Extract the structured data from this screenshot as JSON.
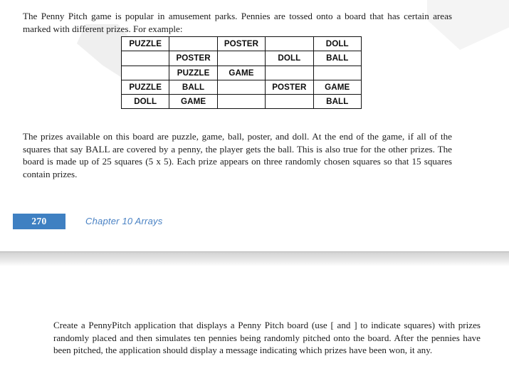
{
  "page_top": {
    "intro_paragraph": "The Penny Pitch game is popular in amusement parks. Pennies are tossed onto a board that has certain areas marked with different prizes. For example:",
    "prizes_paragraph": "The prizes available on this board are puzzle, game, ball, poster, and doll. At the end of the game, if all of the squares that say BALL are covered by a penny, the player gets the ball. This is also true for the other prizes. The board is made up of 25 squares (5 x 5). Each prize appears on three randomly chosen squares so that 15 squares contain prizes."
  },
  "penny_pitch_board": {
    "rows": [
      [
        "PUZZLE",
        "",
        "POSTER",
        "",
        "DOLL"
      ],
      [
        "",
        "POSTER",
        "",
        "DOLL",
        "BALL"
      ],
      [
        "",
        "PUZZLE",
        "GAME",
        "",
        ""
      ],
      [
        "PUZZLE",
        "BALL",
        "",
        "POSTER",
        "GAME"
      ],
      [
        "DOLL",
        "GAME",
        "",
        "",
        "BALL"
      ]
    ]
  },
  "footer": {
    "page_number": "270",
    "chapter_label": "Chapter 10 Arrays",
    "page_number_bg": "#3f80c2",
    "chapter_label_color": "#4a82c4"
  },
  "page_bottom": {
    "exercise_paragraph": "Create a PennyPitch application that displays a Penny Pitch board (use [ and ] to indicate squares) with prizes randomly placed and then simulates ten pennies being randomly pitched onto the board. After the pennies have been pitched, the application should display a message indicating which prizes have been won, it any."
  }
}
